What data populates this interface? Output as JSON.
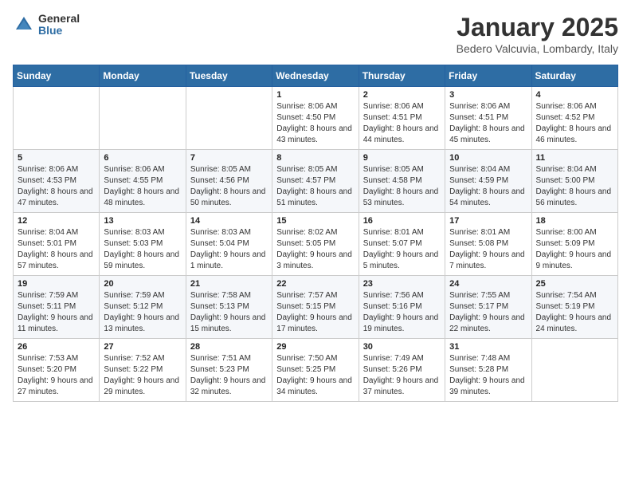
{
  "header": {
    "logo_general": "General",
    "logo_blue": "Blue",
    "month_title": "January 2025",
    "location": "Bedero Valcuvia, Lombardy, Italy"
  },
  "days_of_week": [
    "Sunday",
    "Monday",
    "Tuesday",
    "Wednesday",
    "Thursday",
    "Friday",
    "Saturday"
  ],
  "weeks": [
    [
      {
        "day": "",
        "info": ""
      },
      {
        "day": "",
        "info": ""
      },
      {
        "day": "",
        "info": ""
      },
      {
        "day": "1",
        "info": "Sunrise: 8:06 AM\nSunset: 4:50 PM\nDaylight: 8 hours and 43 minutes."
      },
      {
        "day": "2",
        "info": "Sunrise: 8:06 AM\nSunset: 4:51 PM\nDaylight: 8 hours and 44 minutes."
      },
      {
        "day": "3",
        "info": "Sunrise: 8:06 AM\nSunset: 4:51 PM\nDaylight: 8 hours and 45 minutes."
      },
      {
        "day": "4",
        "info": "Sunrise: 8:06 AM\nSunset: 4:52 PM\nDaylight: 8 hours and 46 minutes."
      }
    ],
    [
      {
        "day": "5",
        "info": "Sunrise: 8:06 AM\nSunset: 4:53 PM\nDaylight: 8 hours and 47 minutes."
      },
      {
        "day": "6",
        "info": "Sunrise: 8:06 AM\nSunset: 4:55 PM\nDaylight: 8 hours and 48 minutes."
      },
      {
        "day": "7",
        "info": "Sunrise: 8:05 AM\nSunset: 4:56 PM\nDaylight: 8 hours and 50 minutes."
      },
      {
        "day": "8",
        "info": "Sunrise: 8:05 AM\nSunset: 4:57 PM\nDaylight: 8 hours and 51 minutes."
      },
      {
        "day": "9",
        "info": "Sunrise: 8:05 AM\nSunset: 4:58 PM\nDaylight: 8 hours and 53 minutes."
      },
      {
        "day": "10",
        "info": "Sunrise: 8:04 AM\nSunset: 4:59 PM\nDaylight: 8 hours and 54 minutes."
      },
      {
        "day": "11",
        "info": "Sunrise: 8:04 AM\nSunset: 5:00 PM\nDaylight: 8 hours and 56 minutes."
      }
    ],
    [
      {
        "day": "12",
        "info": "Sunrise: 8:04 AM\nSunset: 5:01 PM\nDaylight: 8 hours and 57 minutes."
      },
      {
        "day": "13",
        "info": "Sunrise: 8:03 AM\nSunset: 5:03 PM\nDaylight: 8 hours and 59 minutes."
      },
      {
        "day": "14",
        "info": "Sunrise: 8:03 AM\nSunset: 5:04 PM\nDaylight: 9 hours and 1 minute."
      },
      {
        "day": "15",
        "info": "Sunrise: 8:02 AM\nSunset: 5:05 PM\nDaylight: 9 hours and 3 minutes."
      },
      {
        "day": "16",
        "info": "Sunrise: 8:01 AM\nSunset: 5:07 PM\nDaylight: 9 hours and 5 minutes."
      },
      {
        "day": "17",
        "info": "Sunrise: 8:01 AM\nSunset: 5:08 PM\nDaylight: 9 hours and 7 minutes."
      },
      {
        "day": "18",
        "info": "Sunrise: 8:00 AM\nSunset: 5:09 PM\nDaylight: 9 hours and 9 minutes."
      }
    ],
    [
      {
        "day": "19",
        "info": "Sunrise: 7:59 AM\nSunset: 5:11 PM\nDaylight: 9 hours and 11 minutes."
      },
      {
        "day": "20",
        "info": "Sunrise: 7:59 AM\nSunset: 5:12 PM\nDaylight: 9 hours and 13 minutes."
      },
      {
        "day": "21",
        "info": "Sunrise: 7:58 AM\nSunset: 5:13 PM\nDaylight: 9 hours and 15 minutes."
      },
      {
        "day": "22",
        "info": "Sunrise: 7:57 AM\nSunset: 5:15 PM\nDaylight: 9 hours and 17 minutes."
      },
      {
        "day": "23",
        "info": "Sunrise: 7:56 AM\nSunset: 5:16 PM\nDaylight: 9 hours and 19 minutes."
      },
      {
        "day": "24",
        "info": "Sunrise: 7:55 AM\nSunset: 5:17 PM\nDaylight: 9 hours and 22 minutes."
      },
      {
        "day": "25",
        "info": "Sunrise: 7:54 AM\nSunset: 5:19 PM\nDaylight: 9 hours and 24 minutes."
      }
    ],
    [
      {
        "day": "26",
        "info": "Sunrise: 7:53 AM\nSunset: 5:20 PM\nDaylight: 9 hours and 27 minutes."
      },
      {
        "day": "27",
        "info": "Sunrise: 7:52 AM\nSunset: 5:22 PM\nDaylight: 9 hours and 29 minutes."
      },
      {
        "day": "28",
        "info": "Sunrise: 7:51 AM\nSunset: 5:23 PM\nDaylight: 9 hours and 32 minutes."
      },
      {
        "day": "29",
        "info": "Sunrise: 7:50 AM\nSunset: 5:25 PM\nDaylight: 9 hours and 34 minutes."
      },
      {
        "day": "30",
        "info": "Sunrise: 7:49 AM\nSunset: 5:26 PM\nDaylight: 9 hours and 37 minutes."
      },
      {
        "day": "31",
        "info": "Sunrise: 7:48 AM\nSunset: 5:28 PM\nDaylight: 9 hours and 39 minutes."
      },
      {
        "day": "",
        "info": ""
      }
    ]
  ]
}
